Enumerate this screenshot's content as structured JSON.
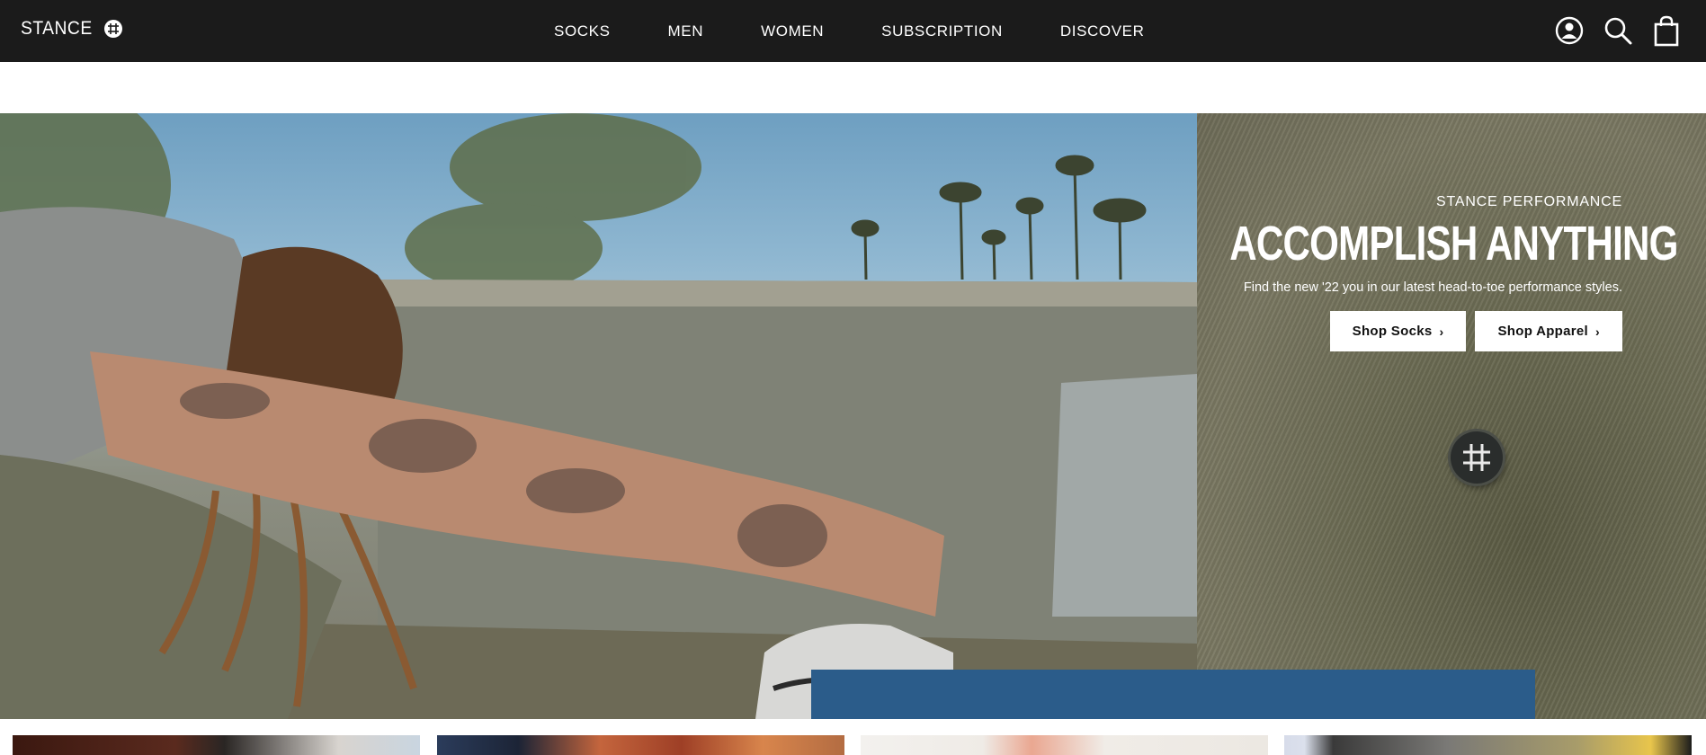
{
  "brand": {
    "name": "STANCE",
    "logo_icon": "stance-cross-logo-icon"
  },
  "nav": {
    "items": [
      {
        "label": "SOCKS"
      },
      {
        "label": "MEN"
      },
      {
        "label": "WOMEN"
      },
      {
        "label": "SUBSCRIPTION"
      },
      {
        "label": "DISCOVER"
      }
    ]
  },
  "header_icons": [
    "account-icon",
    "search-icon",
    "cart-icon"
  ],
  "hero": {
    "eyebrow": "STANCE PERFORMANCE",
    "title": "ACCOMPLISH ANYTHING",
    "subtitle": "Find the new '22 you in our latest head-to-toe performance styles.",
    "buttons": [
      {
        "label": "Shop Socks",
        "icon": "chevron-right-icon"
      },
      {
        "label": "Shop Apparel",
        "icon": "chevron-right-icon"
      }
    ]
  },
  "colors": {
    "header_bg": "#1b1b1b",
    "header_text": "#ffffff",
    "cta_bg": "#ffffff",
    "cta_text": "#111111"
  }
}
